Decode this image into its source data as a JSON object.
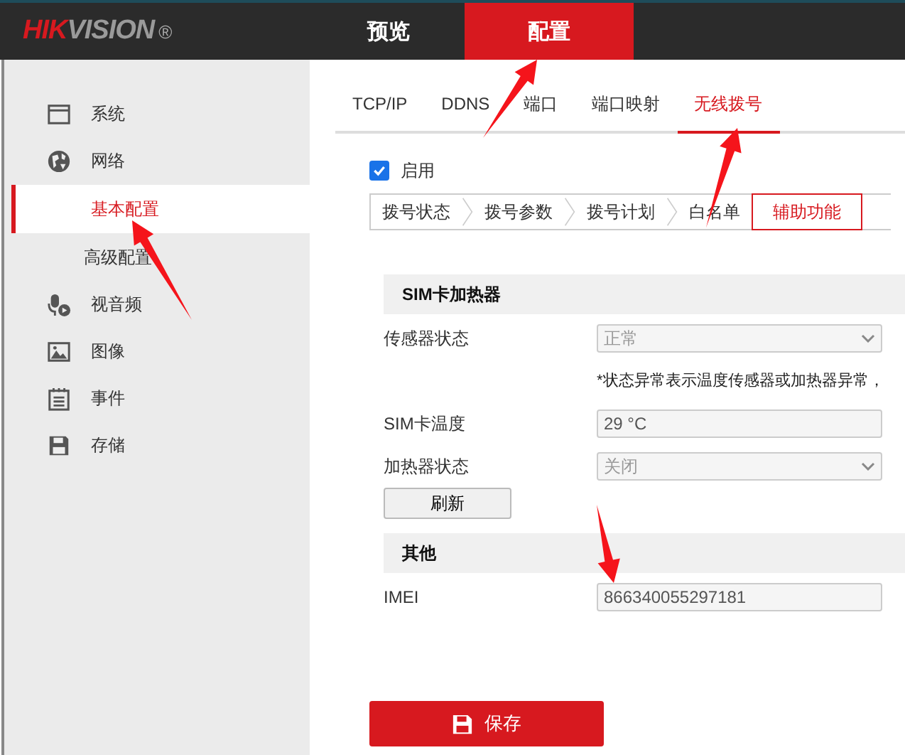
{
  "header": {
    "logo": "HIKVISION",
    "logo_mark": "®",
    "nav": [
      {
        "label": "预览",
        "selected": false
      },
      {
        "label": "配置",
        "selected": true
      }
    ]
  },
  "sidebar": {
    "items": [
      {
        "label": "系统",
        "kind": "window"
      },
      {
        "label": "网络",
        "kind": "globe",
        "children": [
          {
            "label": "基本配置",
            "selected": true
          },
          {
            "label": "高级配置",
            "selected": false
          }
        ]
      },
      {
        "label": "视音频",
        "kind": "mic"
      },
      {
        "label": "图像",
        "kind": "image"
      },
      {
        "label": "事件",
        "kind": "calendar"
      },
      {
        "label": "存储",
        "kind": "disk"
      }
    ]
  },
  "tabs": [
    {
      "label": "TCP/IP",
      "selected": false
    },
    {
      "label": "DDNS",
      "selected": false
    },
    {
      "label": "端口",
      "selected": false
    },
    {
      "label": "端口映射",
      "selected": false
    },
    {
      "label": "无线拨号",
      "selected": true
    }
  ],
  "enable": {
    "label": "启用",
    "checked": true
  },
  "steps": [
    {
      "label": "拨号状态",
      "selected": false
    },
    {
      "label": "拨号参数",
      "selected": false
    },
    {
      "label": "拨号计划",
      "selected": false
    },
    {
      "label": "白名单",
      "selected": false
    },
    {
      "label": "辅助功能",
      "selected": true
    }
  ],
  "sections": [
    {
      "title": "SIM卡加热器",
      "rows": [
        {
          "kind": "select",
          "label": "传感器状态",
          "value": "正常",
          "disabled": true
        },
        {
          "kind": "note",
          "text": "*状态异常表示温度传感器或加热器异常，"
        },
        {
          "kind": "input",
          "label": "SIM卡温度",
          "value": "29 °C"
        },
        {
          "kind": "select",
          "label": "加热器状态",
          "value": "关闭",
          "disabled": true
        },
        {
          "kind": "button",
          "label": "刷新"
        }
      ]
    },
    {
      "title": "其他",
      "rows": [
        {
          "kind": "input",
          "label": "IMEI",
          "value": "866340055297181"
        }
      ]
    }
  ],
  "save_button": "保存"
}
